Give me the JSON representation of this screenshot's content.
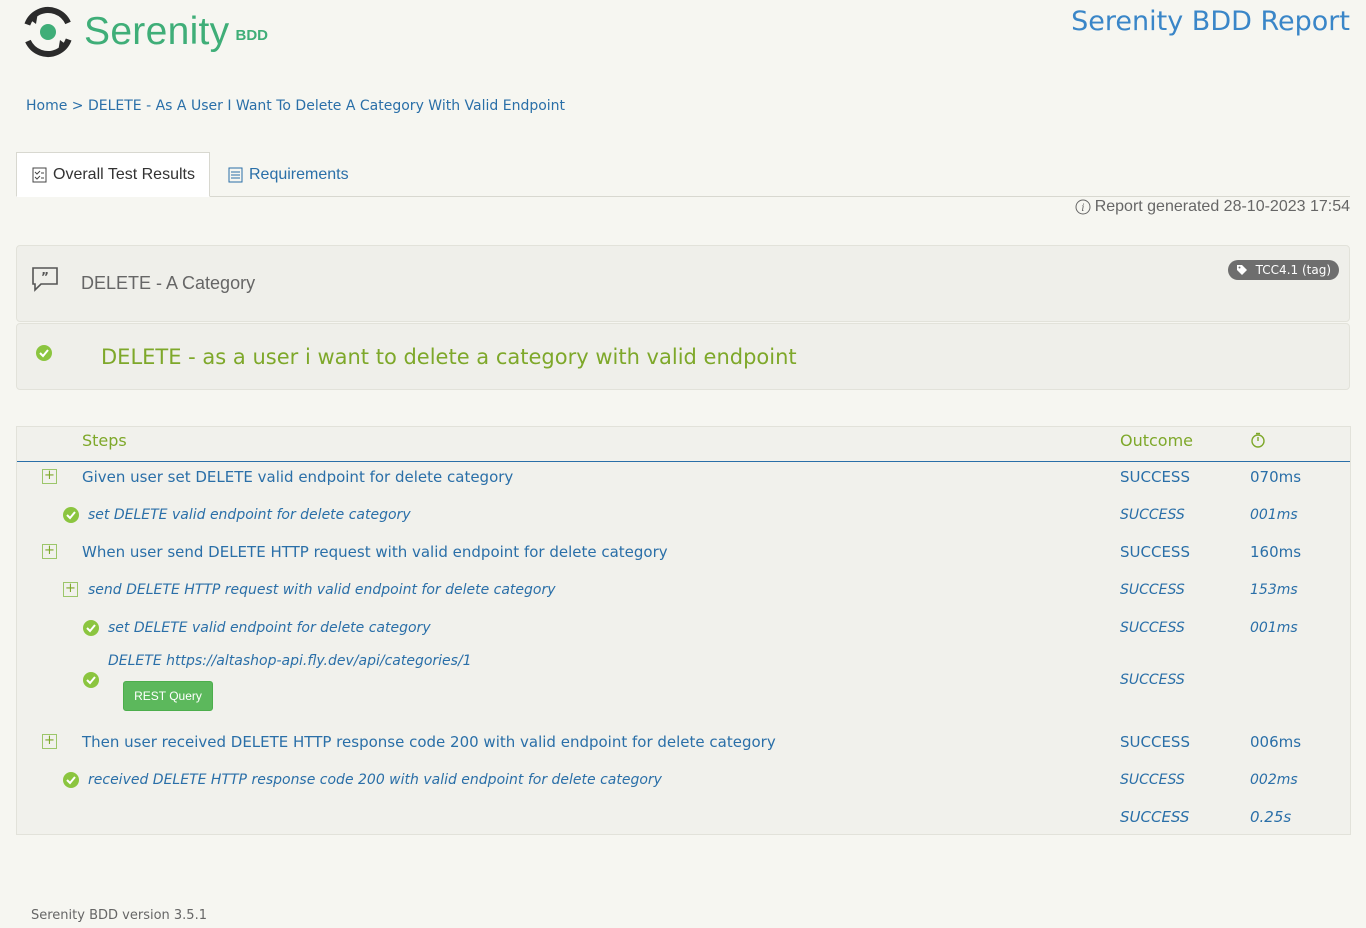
{
  "header": {
    "logo_word": "Serenity",
    "logo_sub": "BDD",
    "report_title": "Serenity BDD Report"
  },
  "breadcrumb": {
    "home": "Home",
    "separator": ">",
    "current": "DELETE - As A User I Want To Delete A Category With Valid Endpoint"
  },
  "tabs": [
    {
      "label": "Overall Test Results",
      "active": true
    },
    {
      "label": "Requirements",
      "active": false
    }
  ],
  "report_generated": "Report generated 28-10-2023 17:54",
  "feature": {
    "title": "DELETE - A Category",
    "tag": "TCC4.1 (tag)"
  },
  "scenario": {
    "title": "DELETE - as a user i want to delete a category with valid endpoint"
  },
  "steps_table": {
    "headers": {
      "steps": "Steps",
      "outcome": "Outcome",
      "duration_icon": "stopwatch-icon"
    },
    "rows": [
      {
        "label": "Given user set DELETE valid endpoint for delete category",
        "outcome": "SUCCESS",
        "duration": "070ms"
      },
      {
        "label": "set DELETE valid endpoint for delete category",
        "outcome": "SUCCESS",
        "duration": "001ms"
      },
      {
        "label": "When user send DELETE HTTP request with valid endpoint for delete category",
        "outcome": "SUCCESS",
        "duration": "160ms"
      },
      {
        "label": "send DELETE HTTP request with valid endpoint for delete category",
        "outcome": "SUCCESS",
        "duration": "153ms"
      },
      {
        "label": "set DELETE valid endpoint for delete category",
        "outcome": "SUCCESS",
        "duration": "001ms"
      },
      {
        "label": "DELETE https://altashop-api.fly.dev/api/categories/1",
        "outcome": "SUCCESS",
        "duration": "",
        "button": "REST Query"
      },
      {
        "label": "Then user received DELETE HTTP response code 200 with valid endpoint for delete category",
        "outcome": "SUCCESS",
        "duration": "006ms"
      },
      {
        "label": "received DELETE HTTP response code 200 with valid endpoint for delete category",
        "outcome": "SUCCESS",
        "duration": "002ms"
      }
    ],
    "total": {
      "outcome": "SUCCESS",
      "duration": "0.25s"
    }
  },
  "footer": "Serenity BDD version 3.5.1",
  "colors": {
    "background": "#f6f6f1",
    "link_blue": "#2a6fa8",
    "success_green": "#7ea82a",
    "button_green": "#5cb85c"
  }
}
